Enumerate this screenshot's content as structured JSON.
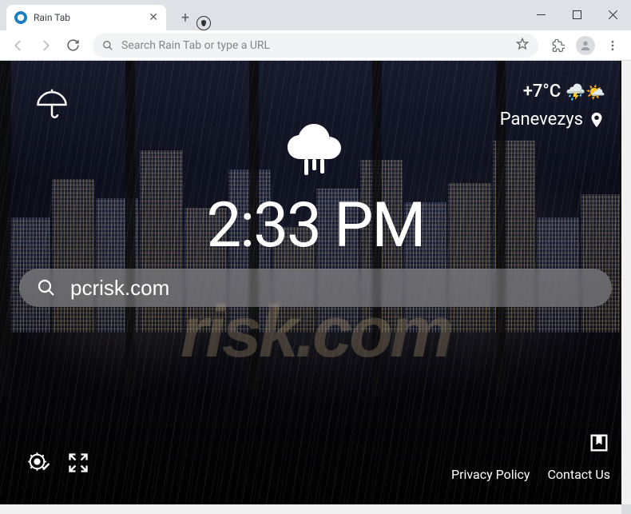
{
  "window": {
    "tab_title": "Rain Tab"
  },
  "toolbar": {
    "omnibox_placeholder": "Search Rain Tab or type a URL"
  },
  "weather": {
    "temperature": "+7°C",
    "condition_emoji": "⛈️🌤️",
    "location": "Panevezys"
  },
  "clock": {
    "time": "2:33 PM"
  },
  "search": {
    "value": "pcrisk.com"
  },
  "footer": {
    "privacy": "Privacy Policy",
    "contact": "Contact Us"
  },
  "watermark": "risk.com"
}
